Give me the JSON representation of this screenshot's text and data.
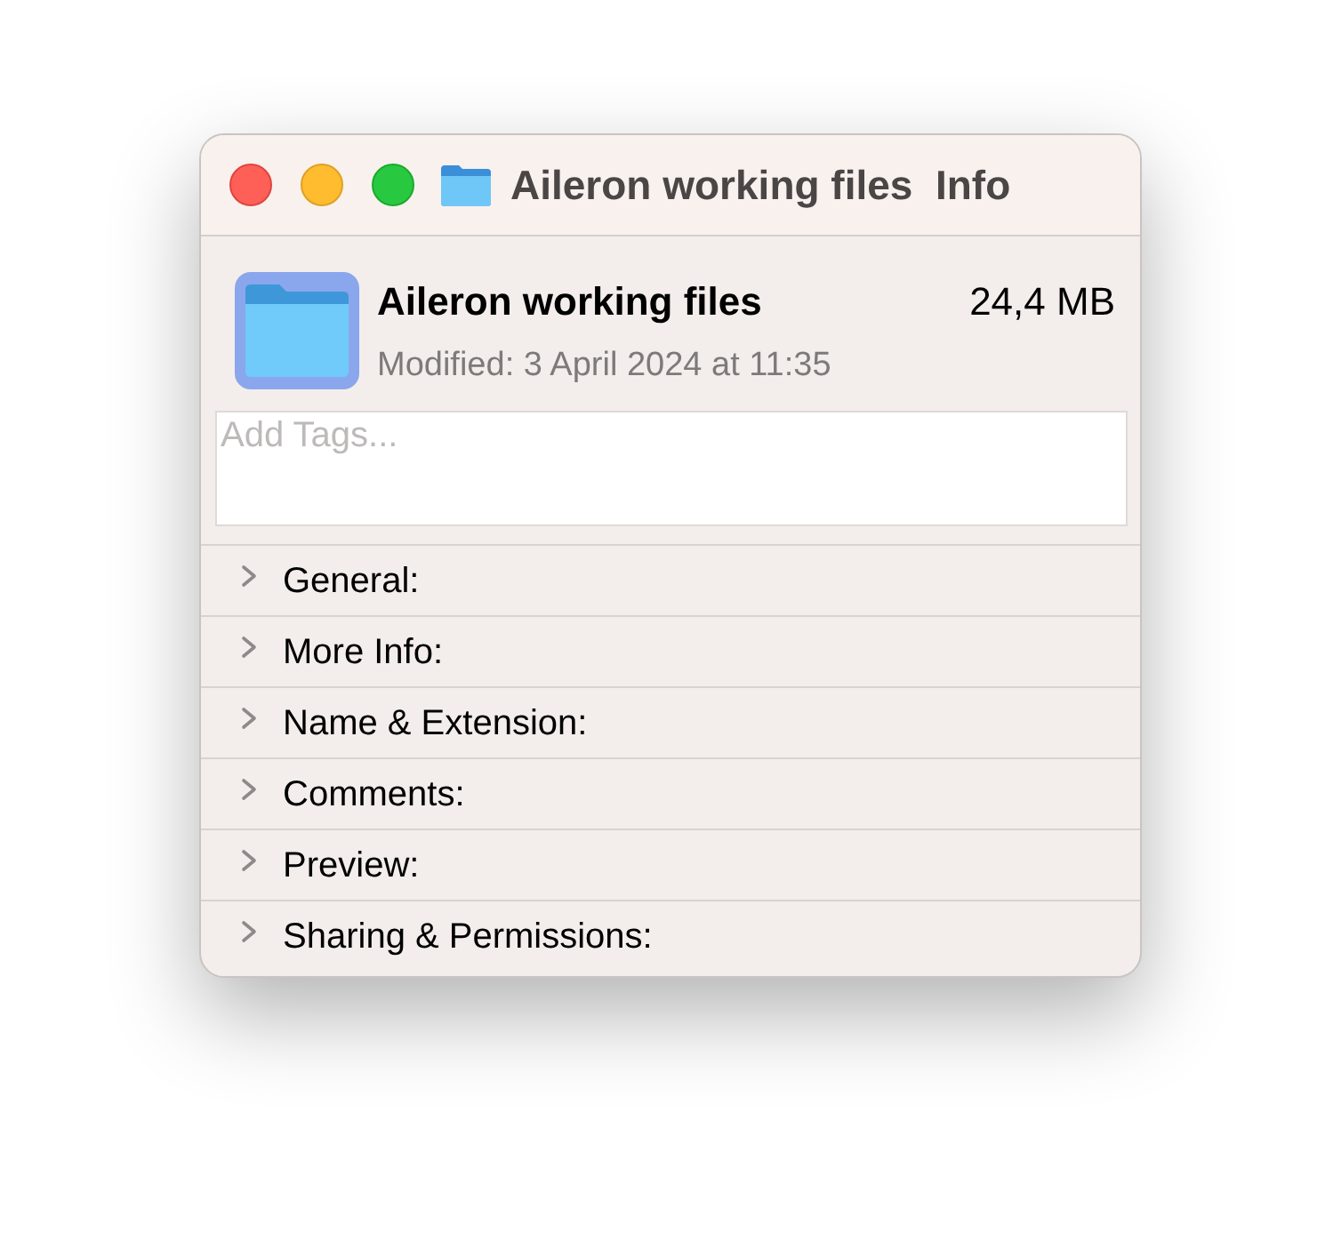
{
  "window": {
    "title": "Aileron working files  Info"
  },
  "header": {
    "name": "Aileron working files",
    "size": "24,4 MB",
    "modified": "Modified: 3 April 2024 at 11:35"
  },
  "tags": {
    "placeholder": "Add Tags..."
  },
  "sections": [
    {
      "label": "General:",
      "expanded": false
    },
    {
      "label": "More Info:",
      "expanded": false
    },
    {
      "label": "Name & Extension:",
      "expanded": false
    },
    {
      "label": "Comments:",
      "expanded": false
    },
    {
      "label": "Preview:",
      "expanded": false
    },
    {
      "label": "Sharing & Permissions:",
      "expanded": false
    }
  ]
}
